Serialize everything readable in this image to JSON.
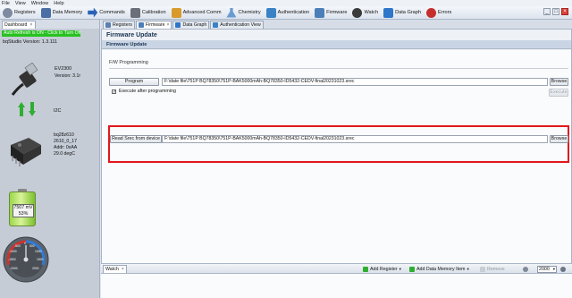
{
  "menu": [
    "File",
    "View",
    "Window",
    "Help"
  ],
  "toolbar": {
    "items": [
      {
        "label": "Registers",
        "icon": "gear-icon",
        "color": "#7d8aa0"
      },
      {
        "label": "Data Memory",
        "icon": "chip-icon",
        "color": "#4a6fa5"
      },
      {
        "label": "Commands",
        "icon": "arrow-icon",
        "color": "#2b62b8"
      },
      {
        "label": "Calibration",
        "icon": "calibration-icon",
        "color": "#6a6f7a"
      },
      {
        "label": "Advanced Comm",
        "icon": "comm-icon",
        "color": "#d79a2b"
      },
      {
        "label": "Chemistry",
        "icon": "flask-icon",
        "color": "#6a9bd1"
      },
      {
        "label": "Authentication",
        "icon": "key-icon",
        "color": "#3a82c6"
      },
      {
        "label": "Firmware",
        "icon": "firmware-icon",
        "color": "#4c7fb8"
      },
      {
        "label": "Watch",
        "icon": "glasses-icon",
        "color": "#3a3a3a"
      },
      {
        "label": "Data Graph",
        "icon": "graph-icon",
        "color": "#2e76c9"
      },
      {
        "label": "Errors",
        "icon": "error-icon",
        "color": "#c62e2e"
      }
    ]
  },
  "left": {
    "tab_label": "Dashboard",
    "auto_refresh": "Auto Refresh is ON - Click to Turn Off",
    "bq_version": "bqStudio Version:  1.3.111",
    "ev_name": "EV2300",
    "ev_version": "Version: 3.1r",
    "bus": "I2C",
    "chip_lines": [
      "bq28z610",
      "2610_0_17",
      "Addr: 0xAA",
      "29.0 degC"
    ],
    "battery_voltage": "7507 mV",
    "battery_percent": "53%",
    "gauge_ticks": [
      "500",
      "1000",
      "1500",
      "2000",
      "-2000",
      "-1500",
      "-1000",
      "-500",
      "0"
    ]
  },
  "tabs": [
    {
      "label": "Registers",
      "icon": "registers-icon",
      "color": "#5b7fb0"
    },
    {
      "label": "Firmware",
      "icon": "firmware-icon",
      "color": "#4c7fb8",
      "active": true
    },
    {
      "label": "Data Graph",
      "icon": "graph-icon",
      "color": "#2e76c9"
    },
    {
      "label": "Authentication View",
      "icon": "key-icon",
      "color": "#3a82c6"
    }
  ],
  "firmware": {
    "title": "Firmware Update",
    "subheader": "Firmware Update",
    "section_label": "F/W Programming",
    "program_label": "Program",
    "program_path": "F:\\date file\\751P BQ78350\\751P-BAK5000mAh-BQ78350-ID5432-CEDV-final20231023.srec",
    "browse_label": "Browse",
    "execute_after_label": "Execute after programming",
    "execute_label": "Execute",
    "read_label": "Read Srec from device",
    "read_path": "F:\\date file\\751P BQ78350\\751P-BAK5000mAh-BQ78350-ID5432-CEDV-final20231023.srec",
    "browse2_label": "Browse"
  },
  "watch": {
    "tab_label": "Watch",
    "add_register": "Add Register",
    "add_data_memory": "Add Data Memory Item",
    "remove": "Remove",
    "interval": "2000"
  },
  "colors": {
    "highlight": "#e0181c",
    "auto_refresh_bg": "#27c21f"
  }
}
